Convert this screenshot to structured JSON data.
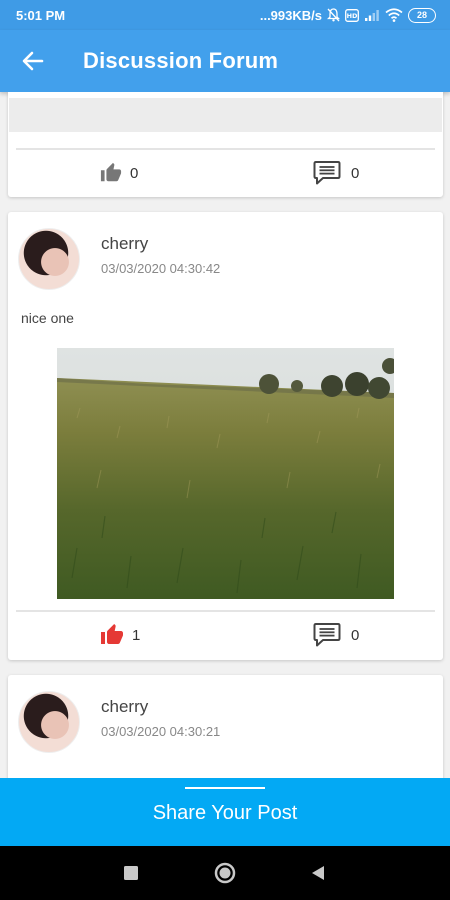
{
  "status_bar": {
    "time": "5:01 PM",
    "network_speed": "...993KB/s",
    "battery": "28",
    "icons": [
      "alarm-off-icon",
      "volte-icon",
      "signal-icon",
      "wifi-icon",
      "battery-icon"
    ]
  },
  "app_bar": {
    "back_icon": "arrow-left-icon",
    "title": "Discussion Forum"
  },
  "posts": [
    {
      "likes": "0",
      "comments": "0",
      "liked": false
    },
    {
      "author": "cherry",
      "timestamp": "03/03/2020 04:30:42",
      "text": "nice one",
      "image": "wheat-field-photo",
      "likes": "1",
      "comments": "0",
      "liked": true
    },
    {
      "author": "cherry",
      "timestamp": "03/03/2020 04:30:21"
    }
  ],
  "share_button": {
    "label": "Share Your Post"
  },
  "nav_bar": {
    "icons": [
      "recents-square-icon",
      "home-circle-icon",
      "back-triangle-icon"
    ]
  },
  "colors": {
    "status_bar": "#3f9be6",
    "app_bar": "#42a0ec",
    "share_bar": "#03a9f4",
    "like_active": "#e53935",
    "like_inactive": "#777777",
    "nav_bar": "#000000"
  }
}
